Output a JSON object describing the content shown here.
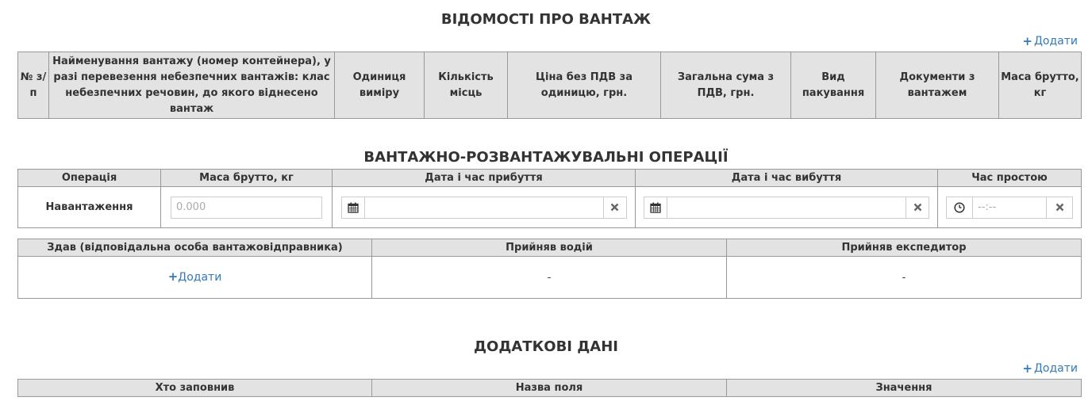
{
  "cargo_section": {
    "title": "ВІДОМОСТІ ПРО ВАНТАЖ",
    "add_label": "Додати",
    "columns": [
      "№ з/п",
      "Найменування вантажу (номер контейнера), у разі перевезення небезпечних вантажів: клас небезпечних речовин, до якого віднесено вантаж",
      "Одиниця виміру",
      "Кількість місць",
      "Ціна без ПДВ за одиницю, грн.",
      "Загальна сума з ПДВ, грн.",
      "Вид пакування",
      "Документи з вантажем",
      "Маса брутто, кг"
    ]
  },
  "operations_section": {
    "title": "ВАНТАЖНО-РОЗВАНТАЖУВАЛЬНІ ОПЕРАЦІЇ",
    "columns": [
      "Операція",
      "Маса брутто, кг",
      "Дата і час прибуття",
      "Дата і час вибуття",
      "Час простою"
    ],
    "row": {
      "operation": "Навантаження",
      "mass_placeholder": "0.000",
      "arrival_value": "",
      "departure_value": "",
      "downtime_placeholder": "--:--"
    }
  },
  "signatures": {
    "columns": [
      "Здав (відповідальна особа вантажовідправника)",
      "Прийняв водій",
      "Прийняв експедитор"
    ],
    "add_label": "Додати",
    "driver_value": "-",
    "forwarder_value": "-"
  },
  "additional_section": {
    "title": "ДОДАТКОВІ ДАНІ",
    "add_label": "Додати",
    "columns": [
      "Хто заповнив",
      "Назва поля",
      "Значення"
    ]
  },
  "colors": {
    "link": "#337ab7",
    "header_bg": "#e3e3e3",
    "border": "#999999"
  },
  "icons": {
    "add": "plus-icon",
    "calendar": "calendar-icon",
    "clear": "clear-icon",
    "clock": "clock-icon"
  }
}
